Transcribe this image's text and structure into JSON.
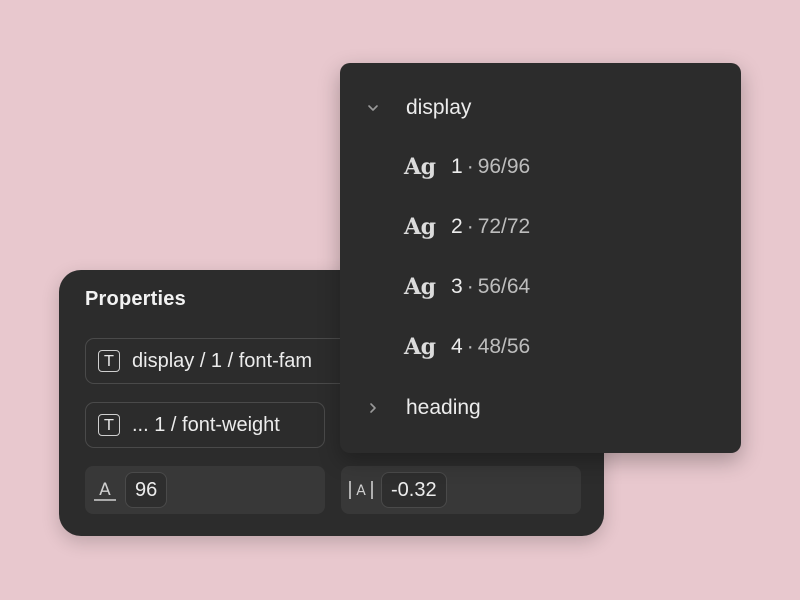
{
  "properties": {
    "title": "Properties",
    "font_family_field": "display / 1 / font-fam",
    "font_weight_field": "... 1 / font-weight",
    "font_size": {
      "icon": "font-size-icon",
      "value": "96"
    },
    "letter_spacing": {
      "icon": "letter-spacing-icon",
      "value": "-0.32"
    }
  },
  "dropdown": {
    "groups": [
      {
        "label": "display",
        "expanded": true,
        "items": [
          {
            "preview": "Ag",
            "name": "1",
            "separator": "·",
            "size": "96/96"
          },
          {
            "preview": "Ag",
            "name": "2",
            "separator": "·",
            "size": "72/72"
          },
          {
            "preview": "Ag",
            "name": "3",
            "separator": "·",
            "size": "56/64"
          },
          {
            "preview": "Ag",
            "name": "4",
            "separator": "·",
            "size": "48/56"
          }
        ]
      },
      {
        "label": "heading",
        "expanded": false
      }
    ]
  },
  "colors": {
    "background": "#e8c8ce",
    "panel": "#2c2c2c",
    "field_border": "#4a4a4a"
  }
}
